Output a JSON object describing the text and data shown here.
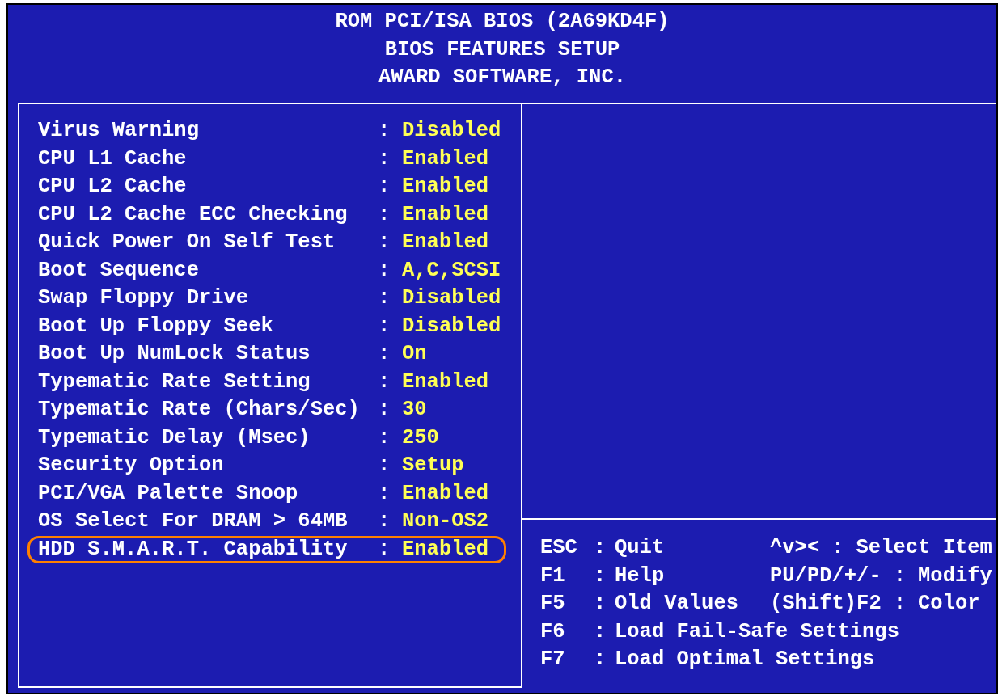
{
  "header": {
    "lines": [
      "ROM PCI/ISA BIOS (2A69KD4F)",
      "BIOS FEATURES SETUP",
      "AWARD SOFTWARE, INC."
    ]
  },
  "settings": [
    {
      "label": "Virus Warning",
      "sep": ":",
      "value": "Disabled",
      "highlighted": false
    },
    {
      "label": "CPU L1 Cache",
      "sep": ":",
      "value": "Enabled",
      "highlighted": false
    },
    {
      "label": "CPU L2 Cache",
      "sep": ":",
      "value": "Enabled",
      "highlighted": false
    },
    {
      "label": "CPU L2 Cache ECC Checking",
      "sep": ":",
      "value": "Enabled",
      "highlighted": false
    },
    {
      "label": "Quick Power On Self Test",
      "sep": ":",
      "value": "Enabled",
      "highlighted": false
    },
    {
      "label": "Boot Sequence",
      "sep": ":",
      "value": "A,C,SCSI",
      "highlighted": false
    },
    {
      "label": "Swap Floppy Drive",
      "sep": ":",
      "value": "Disabled",
      "highlighted": false
    },
    {
      "label": "Boot Up Floppy Seek",
      "sep": ":",
      "value": "Disabled",
      "highlighted": false
    },
    {
      "label": "Boot Up NumLock Status",
      "sep": ":",
      "value": "On",
      "highlighted": false
    },
    {
      "label": "Typematic Rate Setting",
      "sep": ":",
      "value": "Enabled",
      "highlighted": false
    },
    {
      "label": "Typematic Rate (Chars/Sec)",
      "sep": ":",
      "value": "30",
      "highlighted": false
    },
    {
      "label": "Typematic Delay (Msec)",
      "sep": ":",
      "value": "250",
      "highlighted": false
    },
    {
      "label": "Security Option",
      "sep": ":",
      "value": "Setup",
      "highlighted": false
    },
    {
      "label": "PCI/VGA Palette Snoop",
      "sep": ":",
      "value": "Enabled",
      "highlighted": false
    },
    {
      "label": "OS Select For DRAM > 64MB",
      "sep": ":",
      "value": "Non-OS2",
      "highlighted": false
    },
    {
      "label": "HDD S.M.A.R.T. Capability",
      "sep": ":",
      "value": "Enabled",
      "highlighted": true
    }
  ],
  "help": [
    {
      "left": {
        "key": "ESC",
        "sep": ":",
        "action": "Quit"
      },
      "right": {
        "key": "^v><",
        "sep": ":",
        "action": "Select Item"
      }
    },
    {
      "left": {
        "key": "F1",
        "sep": ":",
        "action": "Help"
      },
      "right": {
        "key": "PU/PD/+/-",
        "sep": ":",
        "action": "Modify"
      }
    },
    {
      "left": {
        "key": "F5",
        "sep": ":",
        "action": "Old Values"
      },
      "right": {
        "key": "(Shift)F2",
        "sep": ":",
        "action": "Color"
      }
    },
    {
      "left": {
        "key": "F6",
        "sep": ":",
        "action": "Load Fail-Safe Settings"
      }
    },
    {
      "left": {
        "key": "F7",
        "sep": ":",
        "action": "Load Optimal Settings"
      }
    }
  ]
}
